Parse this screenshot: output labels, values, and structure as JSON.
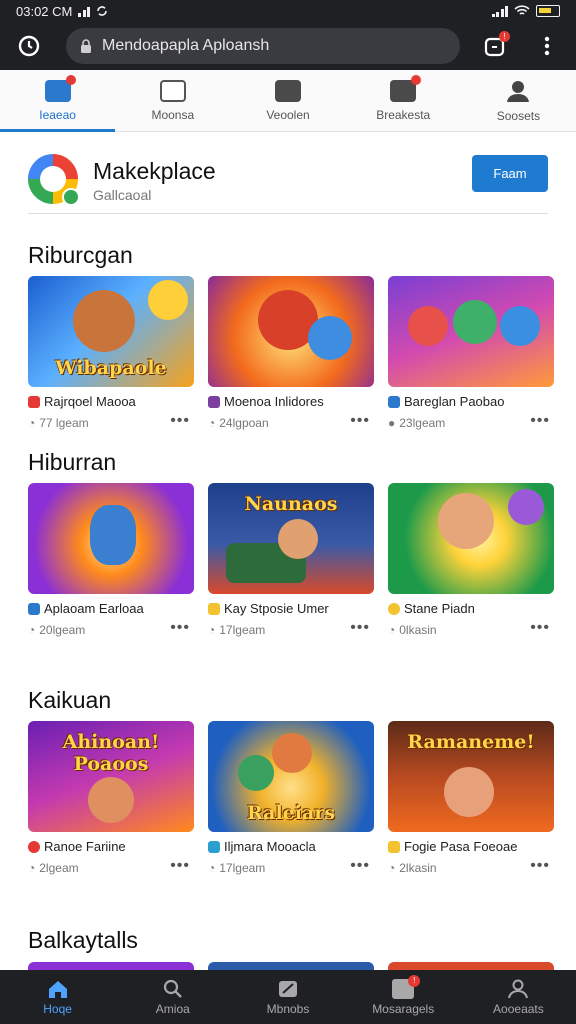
{
  "status_bar": {
    "time": "03:02 CM",
    "carrier": ""
  },
  "browser": {
    "url": "Mendoapapla Aploansh",
    "tab_count_badge": "!"
  },
  "tabs": [
    {
      "label": "Ieaeao",
      "icon": "home-grid-icon",
      "active": true
    },
    {
      "label": "Moonsa",
      "icon": "calendar-icon",
      "active": false
    },
    {
      "label": "Veoolen",
      "icon": "video-icon",
      "active": false
    },
    {
      "label": "Breakesta",
      "icon": "chart-icon",
      "active": false
    },
    {
      "label": "Soosets",
      "icon": "profile-icon",
      "active": false
    }
  ],
  "store": {
    "title": "Makekplace",
    "subtitle": "Gallcaoal",
    "follow_label": "Faam"
  },
  "sections": [
    {
      "title": "Riburcgan",
      "games": [
        {
          "name": "Rajrqoel Maooa",
          "meta": "77 lgeam",
          "icon_color": "#e53935",
          "thumb_text": "Wibapaole",
          "bg": [
            "#1b5fd0",
            "#f7a21b"
          ]
        },
        {
          "name": "Moenoa Inlidores",
          "meta": "24lgpoan",
          "icon_color": "#7b3fa0",
          "thumb_text": "",
          "bg": [
            "#f36b1c",
            "#ffcf3a"
          ]
        },
        {
          "name": "Bareglan Paobao",
          "meta": "23lgeam",
          "icon_color": "#2b79cc",
          "thumb_text": "",
          "bg": [
            "#7a3fd4",
            "#ff7fbf"
          ]
        }
      ]
    },
    {
      "title": "Hiburran",
      "games": [
        {
          "name": "Aplaoam Earloaa",
          "meta": "20lgeam",
          "icon_color": "#2b79cc",
          "thumb_text": "",
          "bg": [
            "#8b2fd6",
            "#ffc02e"
          ]
        },
        {
          "name": "Kay Stposie Umer",
          "meta": "17lgeam",
          "icon_color": "#f2c230",
          "thumb_text": "Naunaos",
          "bg": [
            "#1e3f8a",
            "#d84a2a"
          ]
        },
        {
          "name": "Stane Piadn",
          "meta": "0lkasin",
          "icon_color": "#f2c230",
          "thumb_text": "",
          "bg": [
            "#1c9a4a",
            "#ffd33a"
          ]
        }
      ]
    },
    {
      "title": "Kaikuan",
      "games": [
        {
          "name": "Ranoe Fariine",
          "meta": "2lgeam",
          "icon_color": "#e53935",
          "thumb_text": "Ahinoan! Poaoos",
          "bg": [
            "#6a1fb3",
            "#ff8a1c"
          ]
        },
        {
          "name": "Iljmara Mooacla",
          "meta": "17lgeam",
          "icon_color": "#2b9fd0",
          "thumb_text": "Raleiars",
          "bg": [
            "#1e5fc0",
            "#f2b12a"
          ]
        },
        {
          "name": "Fogie Pasa Foeoae",
          "meta": "2lkasin",
          "icon_color": "#f2c230",
          "thumb_text": "Ramaneme!",
          "bg": [
            "#5c2a18",
            "#ef6a1f"
          ]
        }
      ]
    }
  ],
  "partial_section": {
    "title": "Balkaytalls"
  },
  "bottom_nav": [
    {
      "label": "Hoqe",
      "icon": "home-icon",
      "active": true,
      "badge": ""
    },
    {
      "label": "Amioa",
      "icon": "search-icon",
      "active": false,
      "badge": ""
    },
    {
      "label": "Mbnobs",
      "icon": "edit-icon",
      "active": false,
      "badge": ""
    },
    {
      "label": "Mosaragels",
      "icon": "inbox-icon",
      "active": false,
      "badge": "!"
    },
    {
      "label": "Aooeaats",
      "icon": "account-icon",
      "active": false,
      "badge": ""
    }
  ]
}
